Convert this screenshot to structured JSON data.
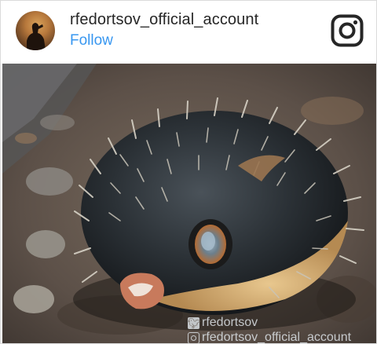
{
  "post": {
    "username": "rfedortsov_official_account",
    "follow_label": "Follow"
  },
  "photo": {
    "watermark_twitter": "rfedortsov",
    "watermark_instagram": "rfedortsov_official_account"
  },
  "icons": {
    "brand": "instagram-icon",
    "watermark_twitter": "twitter-icon",
    "watermark_instagram": "instagram-icon"
  },
  "colors": {
    "follow": "#3897f0",
    "username": "#262626",
    "border": "#dbdbdb"
  }
}
